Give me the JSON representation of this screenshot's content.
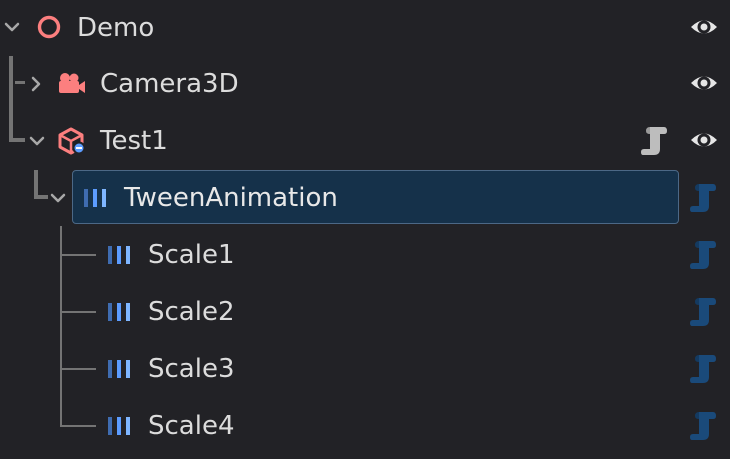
{
  "scene_tree": {
    "nodes": [
      {
        "label": "Demo",
        "icon": "circle-node-icon",
        "expanded": true
      },
      {
        "label": "Camera3D",
        "icon": "camera3d-icon",
        "expanded": false
      },
      {
        "label": "Test1",
        "icon": "node3d-scene-icon",
        "expanded": true
      },
      {
        "label": "TweenAnimation",
        "icon": "tween-animation-icon",
        "expanded": true,
        "selected": true
      },
      {
        "label": "Scale1",
        "icon": "tween-animation-icon"
      },
      {
        "label": "Scale2",
        "icon": "tween-animation-icon"
      },
      {
        "label": "Scale3",
        "icon": "tween-animation-icon"
      },
      {
        "label": "Scale4",
        "icon": "tween-animation-icon"
      }
    ]
  },
  "colors": {
    "background": "#222226",
    "selected_bg": "#15314a",
    "selected_border": "#4c6886",
    "node_red": "#fc7f7f",
    "tween_blue": "#5c9cff",
    "script_blue": "#1a4a7a",
    "text": "#dcdcdc"
  }
}
